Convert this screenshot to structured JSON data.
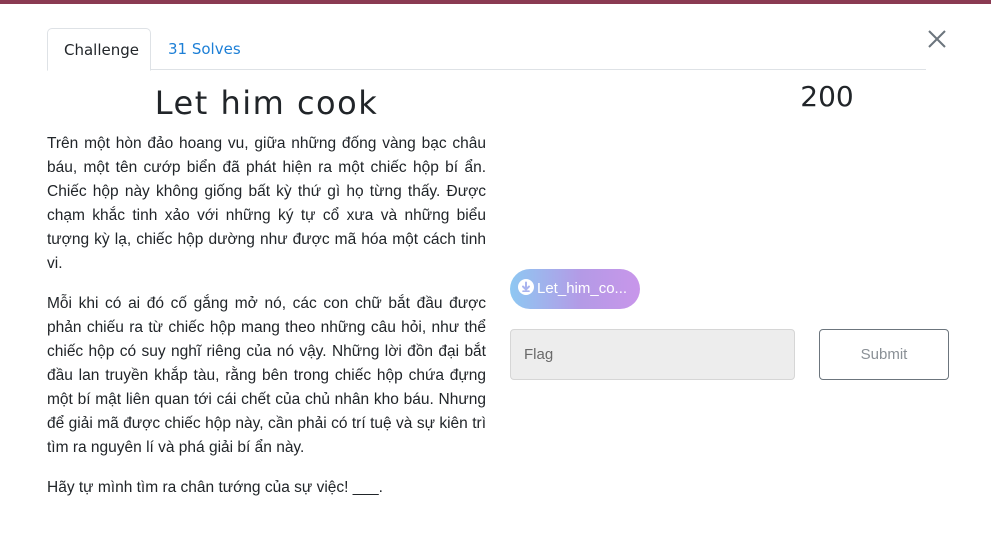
{
  "colors": {
    "accent": "#1d7fd6",
    "top_strip": "#8a3a52",
    "file_gradient_start": "#8ec8f2",
    "file_gradient_end": "#c896ea"
  },
  "tabs": [
    {
      "label": "Challenge",
      "active": true
    },
    {
      "label": "31 Solves",
      "active": false
    }
  ],
  "challenge": {
    "name": "Let him cook",
    "value": "200",
    "description": [
      "Trên một hòn đảo hoang vu, giữa những đống vàng bạc châu báu, một tên cướp biển đã phát hiện ra một chiếc hộp bí ẩn. Chiếc hộp này không giống bất kỳ thứ gì họ từng thấy. Được chạm khắc tinh xảo với những ký tự cổ xưa và những biểu tượng kỳ lạ, chiếc hộp dường như được mã hóa một cách tinh vi.",
      "Mỗi khi có ai đó cố gắng mở nó, các con chữ bắt đầu được phản chiếu ra từ chiếc hộp mang theo những câu hỏi, như thể chiếc hộp có suy nghĩ riêng của nó vậy. Những lời đồn đại bắt đầu lan truyền khắp tàu, rằng bên trong chiếc hộp chứa đựng một bí mật liên quan tới cái chết của chủ nhân kho báu. Nhưng để giải mã được chiếc hộp này, cần phải có trí tuệ và sự kiên trì tìm ra nguyên lí và phá giải bí ẩn này.",
      "Hãy tự mình tìm ra chân tướng của sự việc! ___."
    ],
    "file": {
      "label": "Let_him_co...",
      "icon": "download-circle-icon"
    }
  },
  "form": {
    "flag_placeholder": "Flag",
    "flag_value": "",
    "submit_label": "Submit"
  },
  "icons": {
    "close": "close-icon"
  }
}
